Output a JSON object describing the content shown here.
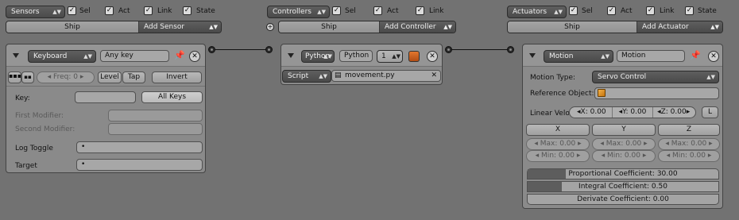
{
  "sensors_col": {
    "type_label": "Sensors",
    "sel": "Sel",
    "act": "Act",
    "link": "Link",
    "state": "State",
    "object_name": "Ship",
    "add_label": "Add Sensor"
  },
  "controllers_col": {
    "type_label": "Controllers",
    "sel": "Sel",
    "act": "Act",
    "link": "Link",
    "object_name": "Ship",
    "add_label": "Add Controller"
  },
  "actuators_col": {
    "type_label": "Actuators",
    "sel": "Sel",
    "act": "Act",
    "link": "Link",
    "state": "State",
    "object_name": "Ship",
    "add_label": "Add Actuator"
  },
  "sensor": {
    "type": "Keyboard",
    "name": "Any key",
    "freq": "Freq: 0",
    "level": "Level",
    "tap": "Tap",
    "invert": "Invert",
    "key_label": "Key:",
    "key_value": "",
    "all_keys": "All Keys",
    "first_modifier": "First Modifier:",
    "second_modifier": "Second Modifier:",
    "log_toggle": "Log Toggle",
    "target": "Target",
    "log_toggle_value": "•",
    "target_value": "•"
  },
  "controller": {
    "type": "Python",
    "name": "Python",
    "state": "1",
    "mode": "Script",
    "script": "movement.py"
  },
  "actuator": {
    "type": "Motion",
    "name": "Motion",
    "motion_type_label": "Motion Type:",
    "motion_type_value": "Servo Control",
    "ref_object_label": "Reference Object:",
    "ref_object_value": "",
    "linear_velo_label": "Linear Velo",
    "lv_x": "X: 0.00",
    "lv_y": "Y: 0.00",
    "lv_z": "Z: 0.00",
    "local_toggle": "L",
    "axes": [
      {
        "header": "X",
        "max": "Max: 0.00",
        "min": "Min: 0.00"
      },
      {
        "header": "Y",
        "max": "Max: 0.00",
        "min": "Min: 0.00"
      },
      {
        "header": "Z",
        "max": "Max: 0.00",
        "min": "Min: 0.00"
      }
    ],
    "coefficients": [
      {
        "label": "Proportional Coefficient: 30.00",
        "fill": 0.2
      },
      {
        "label": "Integral Coefficient: 0.50",
        "fill": 0.18
      },
      {
        "label": "Derivate Coefficient: 0.00",
        "fill": 0.0
      }
    ]
  }
}
